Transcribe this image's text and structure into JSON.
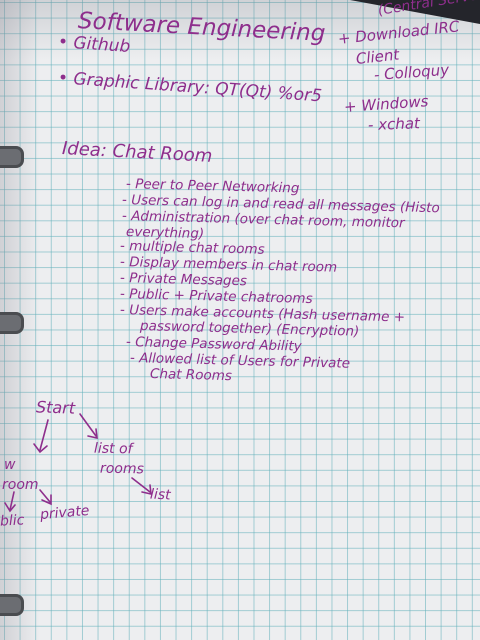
{
  "notes": {
    "title": "Software Engineering",
    "bullets": [
      "• Github",
      "• Graphic Library: QT(Qt) %or5"
    ],
    "server_notes": [
      "(Central Server)",
      "+ Download IRC",
      "Client",
      "- Colloquy",
      "+ Windows",
      "- xchat"
    ],
    "idea_heading": "Idea: Chat Room",
    "features": [
      "- Peer to Peer Networking",
      "- Users can log in and read all messages (Histo",
      "- Administration (over chat room, monitor",
      "everything)",
      "- multiple chat rooms",
      "- Display members in chat room",
      "- Private Messages",
      "- Public + Private chatrooms",
      "- Users make accounts (Hash username +",
      "password together) (Encryption)",
      "- Change Password Ability",
      "- Allowed list of Users for Private",
      "Chat Rooms"
    ]
  },
  "flowchart": {
    "root": "Start",
    "left_branch": [
      "w",
      "room"
    ],
    "right_branch": [
      "list of",
      "rooms"
    ],
    "list_leaf": "list",
    "public_leaf": "blic",
    "private_leaf": "private"
  },
  "colors": {
    "ink": "#8e2e8c",
    "paper": "#edeef0",
    "grid": "#5fafb9"
  }
}
